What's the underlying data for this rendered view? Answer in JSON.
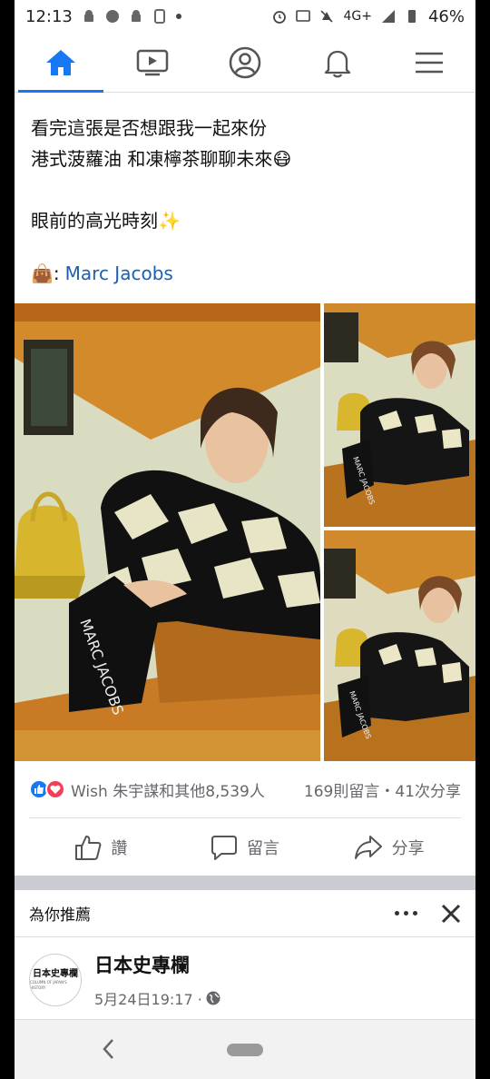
{
  "status_bar": {
    "time": "12:13",
    "network": "4G+",
    "battery": "46%"
  },
  "nav": {
    "items": [
      {
        "icon": "home-icon",
        "active": true
      },
      {
        "icon": "video-icon",
        "active": false
      },
      {
        "icon": "profile-icon",
        "active": false
      },
      {
        "icon": "bell-icon",
        "active": false
      },
      {
        "icon": "menu-icon",
        "active": false
      }
    ],
    "accent": "#1877f2"
  },
  "post": {
    "line1": "看完這張是否想跟我一起來份",
    "line2": "港式菠蘿油 和凍檸茶聊聊未來😷",
    "line3": "眼前的高光時刻✨",
    "brand_emoji": "👜",
    "brand_sep": ":",
    "brand_link": "Marc Jacobs",
    "photo_text": "MARC JACOBS"
  },
  "reactions": {
    "text": "Wish 朱宇謀和其他8,539人",
    "comments": "169則留言",
    "shares": "41次分享",
    "separator_dot": "・"
  },
  "actions": {
    "like": "讚",
    "comment": "留言",
    "share": "分享"
  },
  "suggested": {
    "title": "為你推薦",
    "page_name": "日本史專欄",
    "page_logo_text": "日本史專欄",
    "page_logo_sub": "COLUMN OF JAPAN'S HISTORY",
    "meta": "5月24日19:17 ·"
  }
}
